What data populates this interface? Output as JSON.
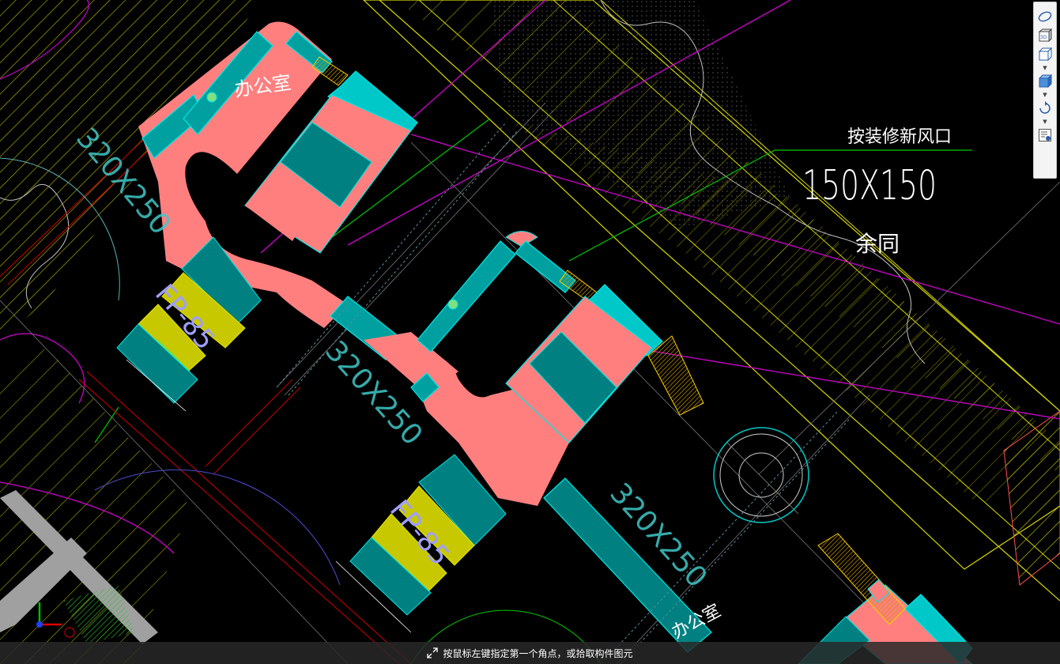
{
  "drawing": {
    "labels": {
      "office_1": "办公室",
      "office_2": "办公室",
      "duct_size_1": "320X250",
      "duct_size_2": "320X250",
      "duct_size_3": "320X250",
      "fan_coil_1": "FP-85",
      "fan_coil_2": "FP-85",
      "note_title": "按装修新风口",
      "note_size": "150X150",
      "note_rest": "余同"
    },
    "colors": {
      "background": "#000000",
      "duct_fill": "#ff7f7f",
      "duct_teal": "#008080",
      "duct_outline": "#00e5e5",
      "fan_coil_yellow": "#c8c800",
      "hatch_yellow": "#e6e600",
      "wall_magenta": "#d000d0",
      "leader_green": "#00c800",
      "axis_red": "#c00000",
      "text_white": "#ffffff",
      "text_cyan": "#7fe0e0",
      "text_lavender": "#9f9fff"
    }
  },
  "toolbar": {
    "buttons": [
      {
        "icon": "orbit-icon"
      },
      {
        "icon": "3d-view-icon",
        "label": "3D"
      },
      {
        "icon": "cube-wireframe-icon"
      },
      {
        "icon": "cube-solid-icon"
      },
      {
        "icon": "rotate-icon"
      },
      {
        "icon": "properties-panel-icon"
      }
    ]
  },
  "status": {
    "prompt": "按鼠标左键指定第一个角点，或拾取构件图元"
  }
}
